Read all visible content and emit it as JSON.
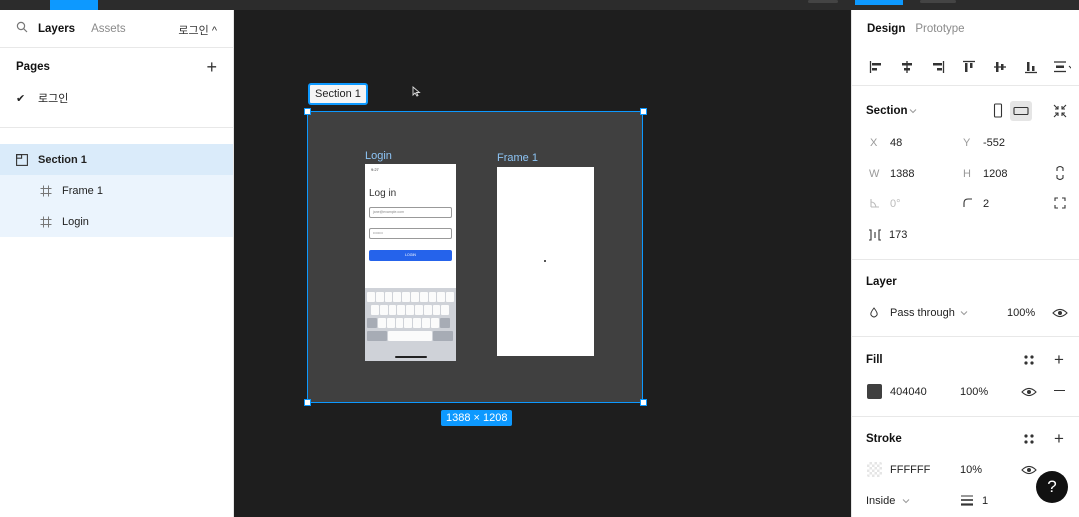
{
  "left_panel": {
    "tabs": {
      "layers": "Layers",
      "assets": "Assets",
      "current_page": "로그인 ^"
    },
    "pages_header": "Pages",
    "pages": [
      {
        "label": "로그인",
        "selected": true
      }
    ],
    "layers": [
      {
        "label": "Section 1",
        "type": "section"
      },
      {
        "label": "Frame 1",
        "type": "frame"
      },
      {
        "label": "Login",
        "type": "frame"
      }
    ]
  },
  "canvas": {
    "section_label": "Section 1",
    "frames": {
      "login": "Login",
      "frame1": "Frame 1"
    },
    "size_badge": "1388 × 1208",
    "section_fill": "#404040",
    "accent": "#0d99ff"
  },
  "phone": {
    "status_time": "9:27",
    "title": "Log in",
    "email_placeholder": "jane@example.com",
    "password_placeholder": "••••••••",
    "button_label": "LOGIN",
    "kb_key_space": "space",
    "kb_key_return": "return",
    "kb_key_123": "123"
  },
  "right_panel": {
    "tabs": {
      "design": "Design",
      "prototype": "Prototype"
    },
    "section": {
      "title": "Section",
      "x_label": "X",
      "x": "48",
      "y_label": "Y",
      "y": "-552",
      "w_label": "W",
      "w": "1388",
      "h_label": "H",
      "h": "1208",
      "rotation": "0°",
      "radius": "2",
      "spacing": "173"
    },
    "layer": {
      "title": "Layer",
      "blend": "Pass through",
      "opacity": "100%"
    },
    "fill": {
      "title": "Fill",
      "color_hex": "404040",
      "opacity": "100%",
      "swatch": "#404040"
    },
    "stroke": {
      "title": "Stroke",
      "color_hex": "FFFFFF",
      "opacity": "10%",
      "position": "Inside",
      "weight": "1"
    }
  },
  "help": "?"
}
